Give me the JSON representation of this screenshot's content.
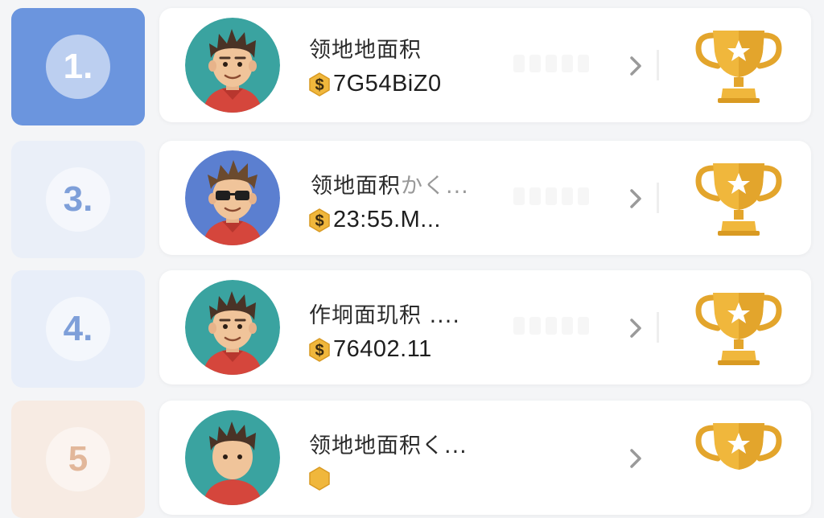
{
  "leaderboard": {
    "rows": [
      {
        "rank": "1.",
        "name": "领地地面积",
        "money": "7G54BiZ0",
        "tile_color": "#6b95de",
        "rank_color": "#ffffff",
        "avatar_bg": "#3aa3a0",
        "avatar_icon": "boy-avatar-icon",
        "sunglasses": false
      },
      {
        "rank": "3.",
        "name": "领地面积",
        "name_suffix": "かく...",
        "money": "23:55.M...",
        "tile_color": "#eaeff8",
        "rank_color": "#7e9fd9",
        "avatar_bg": "#5b7fd0",
        "avatar_icon": "boy-sunglasses-avatar-icon",
        "sunglasses": true
      },
      {
        "rank": "4.",
        "name": "作坰面玑积 ....",
        "money": "76402.11",
        "tile_color": "#e8eef9",
        "rank_color": "#7e9fd9",
        "avatar_bg": "#3aa3a0",
        "avatar_icon": "boy-avatar-icon",
        "sunglasses": false
      },
      {
        "rank": "5",
        "name": "领地地面积く...",
        "money": "",
        "tile_color": "#f7ebe3",
        "rank_color": "#e2b79a",
        "avatar_bg": "#cfe3ef",
        "avatar_icon": "boy-avatar-icon",
        "sunglasses": false
      }
    ],
    "colors": {
      "gold": "#f0b73c",
      "gold_dark": "#d99a22",
      "chevron": "#9a9a9a"
    }
  }
}
